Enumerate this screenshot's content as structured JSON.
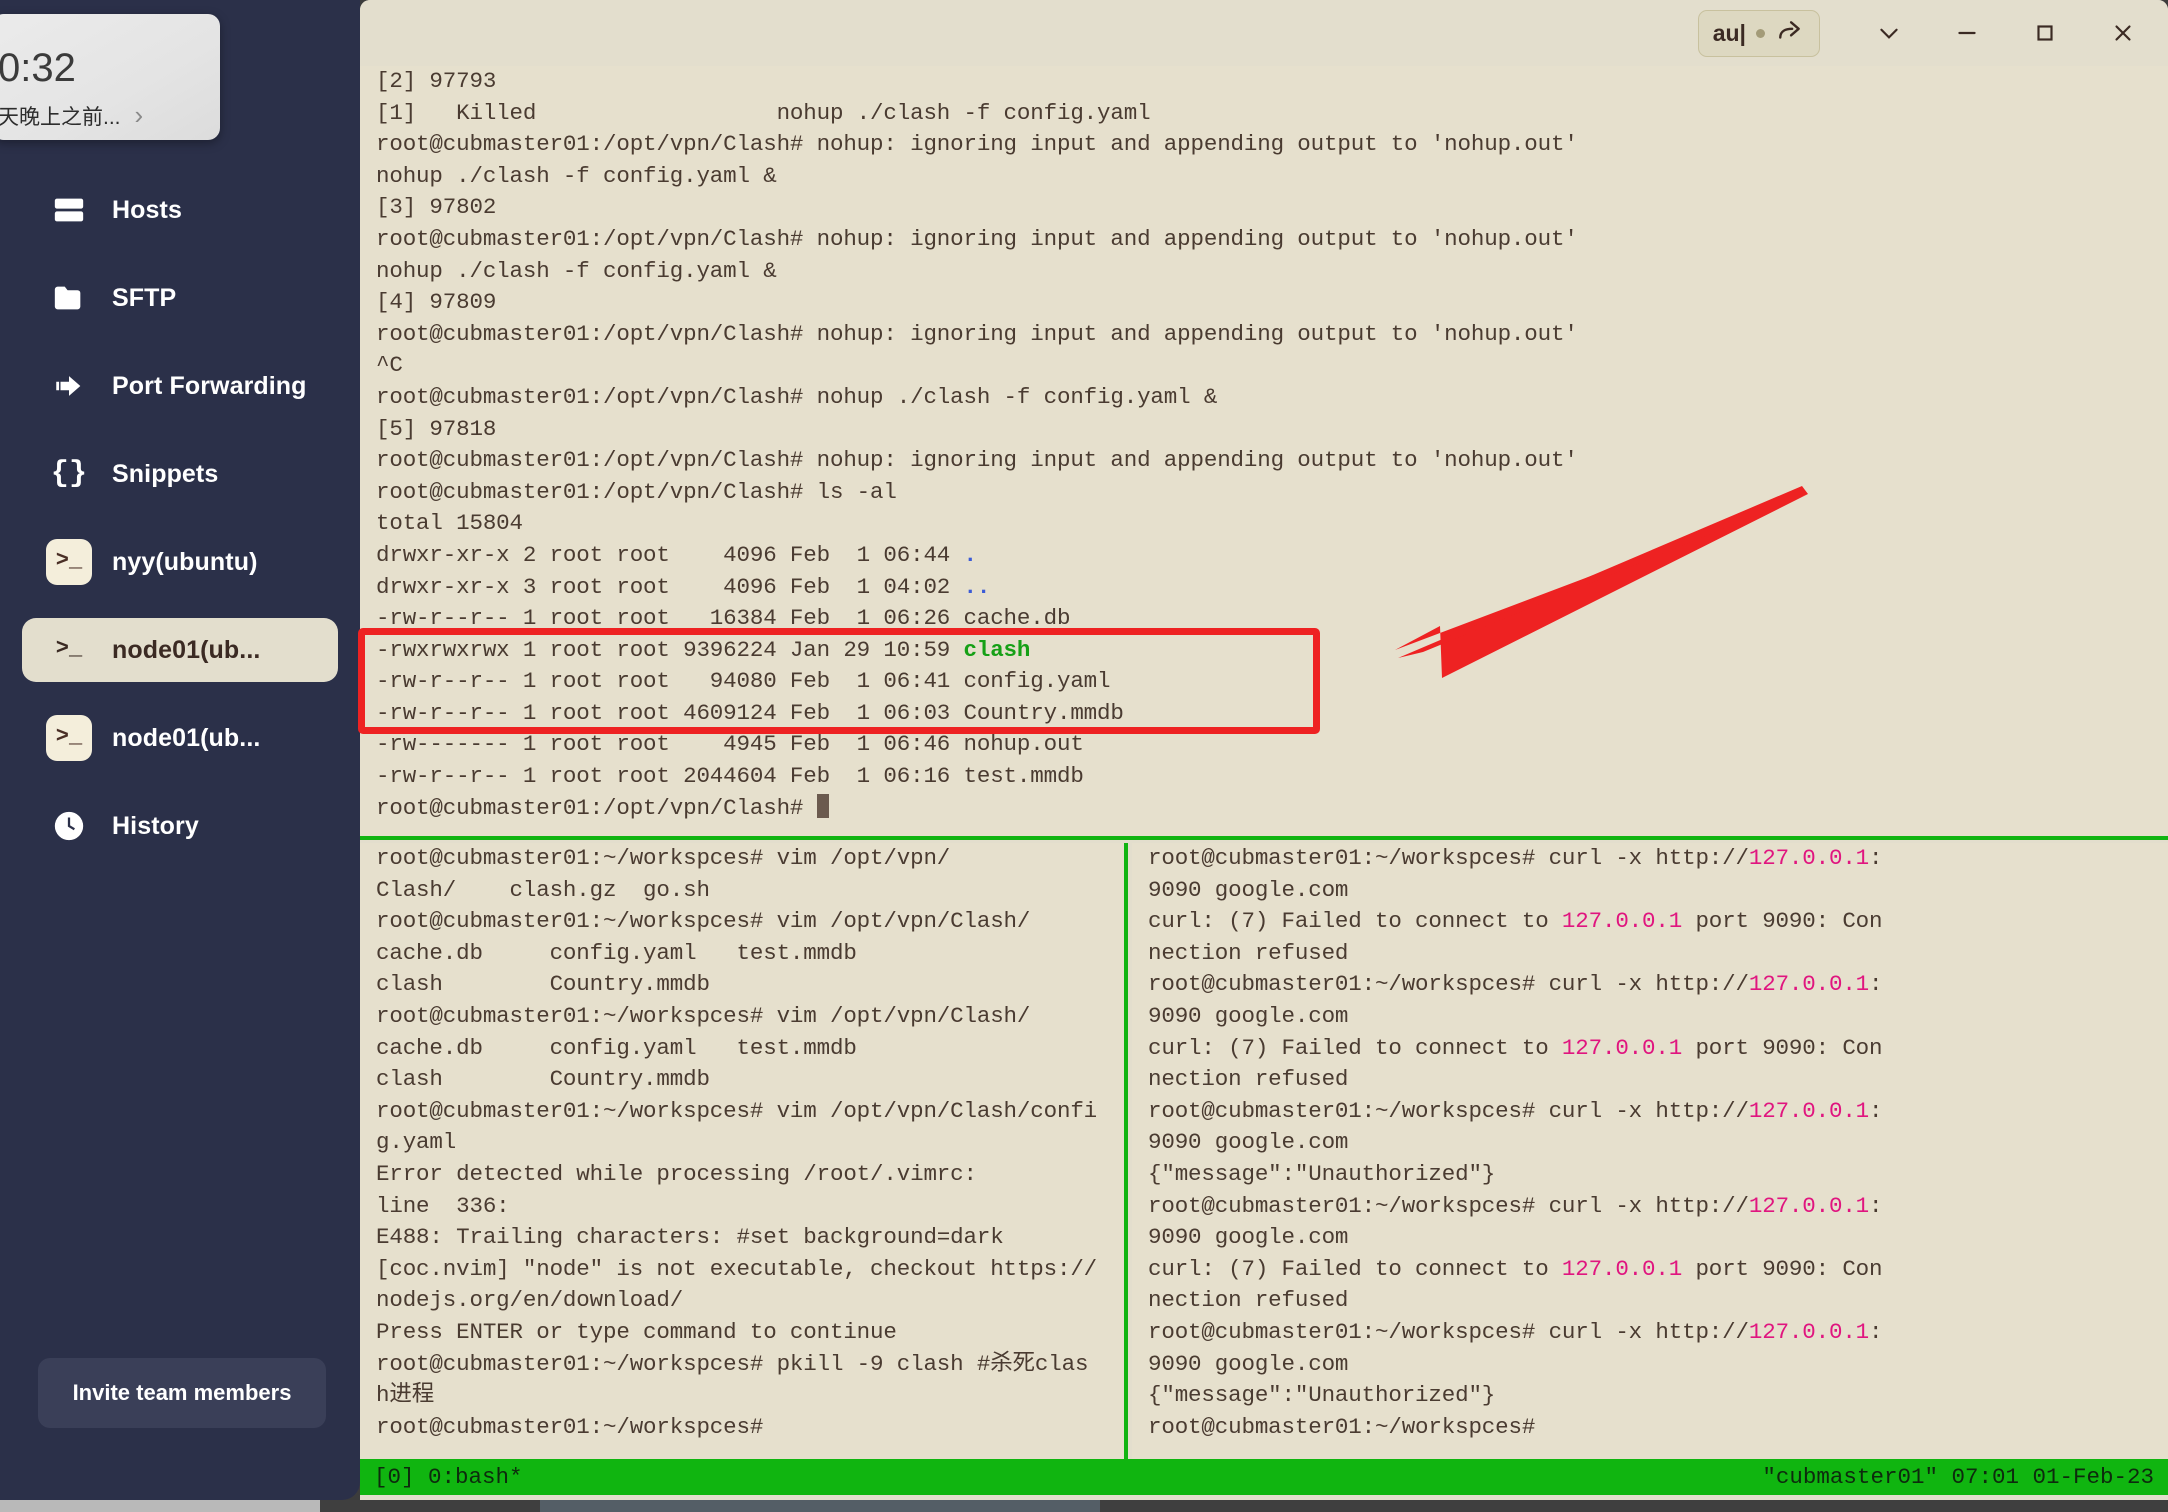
{
  "popup": {
    "time": "0:32",
    "message": "天晚上之前...",
    "chevron": "chevron-right-icon"
  },
  "sidebar": {
    "top_icons": [
      {
        "name": "notification-bell-icon",
        "badge": true
      },
      {
        "name": "terminal-icon",
        "glyph": ">_"
      }
    ],
    "items": [
      {
        "label": "Hosts",
        "icon": "server-icon",
        "active": false
      },
      {
        "label": "SFTP",
        "icon": "folder-icon",
        "active": false
      },
      {
        "label": "Port Forwarding",
        "icon": "forward-icon",
        "active": false
      },
      {
        "label": "Snippets",
        "icon": "braces-icon",
        "active": false
      },
      {
        "label": "nyy(ubuntu)",
        "icon": "terminal-icon",
        "active": false
      },
      {
        "label": "node01(ub...",
        "icon": "terminal-icon",
        "active": true
      },
      {
        "label": "node01(ub...",
        "icon": "terminal-icon",
        "active": false
      },
      {
        "label": "History",
        "icon": "clock-icon",
        "active": false
      }
    ],
    "invite_button": "Invite team members"
  },
  "titlebar": {
    "badge_text": "au|",
    "badge_icons": [
      "dot-indicator",
      "share-arrow-icon"
    ],
    "buttons": [
      {
        "name": "chevron-down-button",
        "glyph": "chevron-down-icon"
      },
      {
        "name": "minimize-button",
        "glyph": "minimize-icon"
      },
      {
        "name": "maximize-button",
        "glyph": "maximize-icon"
      },
      {
        "name": "close-button",
        "glyph": "close-icon"
      }
    ]
  },
  "terminal": {
    "pane_top_lines": [
      "[2] 97793",
      "[1]   Killed                  nohup ./clash -f config.yaml",
      "root@cubmaster01:/opt/vpn/Clash# nohup: ignoring input and appending output to 'nohup.out'",
      "nohup ./clash -f config.yaml &",
      "[3] 97802",
      "root@cubmaster01:/opt/vpn/Clash# nohup: ignoring input and appending output to 'nohup.out'",
      "nohup ./clash -f config.yaml &",
      "[4] 97809",
      "root@cubmaster01:/opt/vpn/Clash# nohup: ignoring input and appending output to 'nohup.out'",
      "^C",
      "root@cubmaster01:/opt/vpn/Clash# nohup ./clash -f config.yaml &",
      "[5] 97818",
      "root@cubmaster01:/opt/vpn/Clash# nohup: ignoring input and appending output to 'nohup.out'",
      "root@cubmaster01:/opt/vpn/Clash# ls -al",
      "total 15804",
      "drwxr-xr-x 2 root root    4096 Feb  1 06:44 .",
      "drwxr-xr-x 3 root root    4096 Feb  1 04:02 ..",
      "-rw-r--r-- 1 root root   16384 Feb  1 06:26 cache.db",
      "-rwxrwxrwx 1 root root 9396224 Jan 29 10:59 clash",
      "-rw-r--r-- 1 root root   94080 Feb  1 06:41 config.yaml",
      "-rw-r--r-- 1 root root 4609124 Feb  1 06:03 Country.mmdb",
      "-rw------- 1 root root    4945 Feb  1 06:46 nohup.out",
      "-rw-r--r-- 1 root root 2044604 Feb  1 06:16 test.mmdb",
      "root@cubmaster01:/opt/vpn/Clash# "
    ],
    "pane_bottom_left_lines": [
      "root@cubmaster01:~/workspces# vim /opt/vpn/",
      "Clash/    clash.gz  go.sh",
      "root@cubmaster01:~/workspces# vim /opt/vpn/Clash/",
      "cache.db     config.yaml   test.mmdb",
      "clash        Country.mmdb",
      "root@cubmaster01:~/workspces# vim /opt/vpn/Clash/",
      "cache.db     config.yaml   test.mmdb",
      "clash        Country.mmdb",
      "root@cubmaster01:~/workspces# vim /opt/vpn/Clash/confi",
      "g.yaml",
      "Error detected while processing /root/.vimrc:",
      "line  336:",
      "E488: Trailing characters: #set background=dark",
      "[coc.nvim] \"node\" is not executable, checkout https://",
      "nodejs.org/en/download/",
      "Press ENTER or type command to continue",
      "root@cubmaster01:~/workspces# pkill -9 clash #杀死clas",
      "h进程",
      "root@cubmaster01:~/workspces#"
    ],
    "pane_bottom_right_lines": [
      "root@cubmaster01:~/workspces# curl -x http://127.0.0.1:",
      "9090 google.com",
      "curl: (7) Failed to connect to 127.0.0.1 port 9090: Con",
      "nection refused",
      "root@cubmaster01:~/workspces# curl -x http://127.0.0.1:",
      "9090 google.com",
      "curl: (7) Failed to connect to 127.0.0.1 port 9090: Con",
      "nection refused",
      "root@cubmaster01:~/workspces# curl -x http://127.0.0.1:",
      "9090 google.com",
      "{\"message\":\"Unauthorized\"}",
      "root@cubmaster01:~/workspces# curl -x http://127.0.0.1:",
      "9090 google.com",
      "curl: (7) Failed to connect to 127.0.0.1 port 9090: Con",
      "nection refused",
      "root@cubmaster01:~/workspces# curl -x http://127.0.0.1:",
      "9090 google.com",
      "{\"message\":\"Unauthorized\"}",
      "root@cubmaster01:~/workspces#"
    ],
    "statusbar_left": "[0] 0:bash*",
    "statusbar_right": "\"cubmaster01\" 07:01 01-Feb-23"
  },
  "annotations": {
    "highlight_box": "red-rectangle-highlight",
    "arrow": "red-arrow-pointing-left"
  },
  "colors": {
    "sidebar_bg": "#2b3049",
    "terminal_bg": "#e6e0cd",
    "accent_active": "#e3decd",
    "tmux_green": "#10b510",
    "annotation_red": "#ee2222",
    "exec_green": "#16a016",
    "dir_blue": "#3b5bd6",
    "ip_magenta": "#e0157f"
  }
}
